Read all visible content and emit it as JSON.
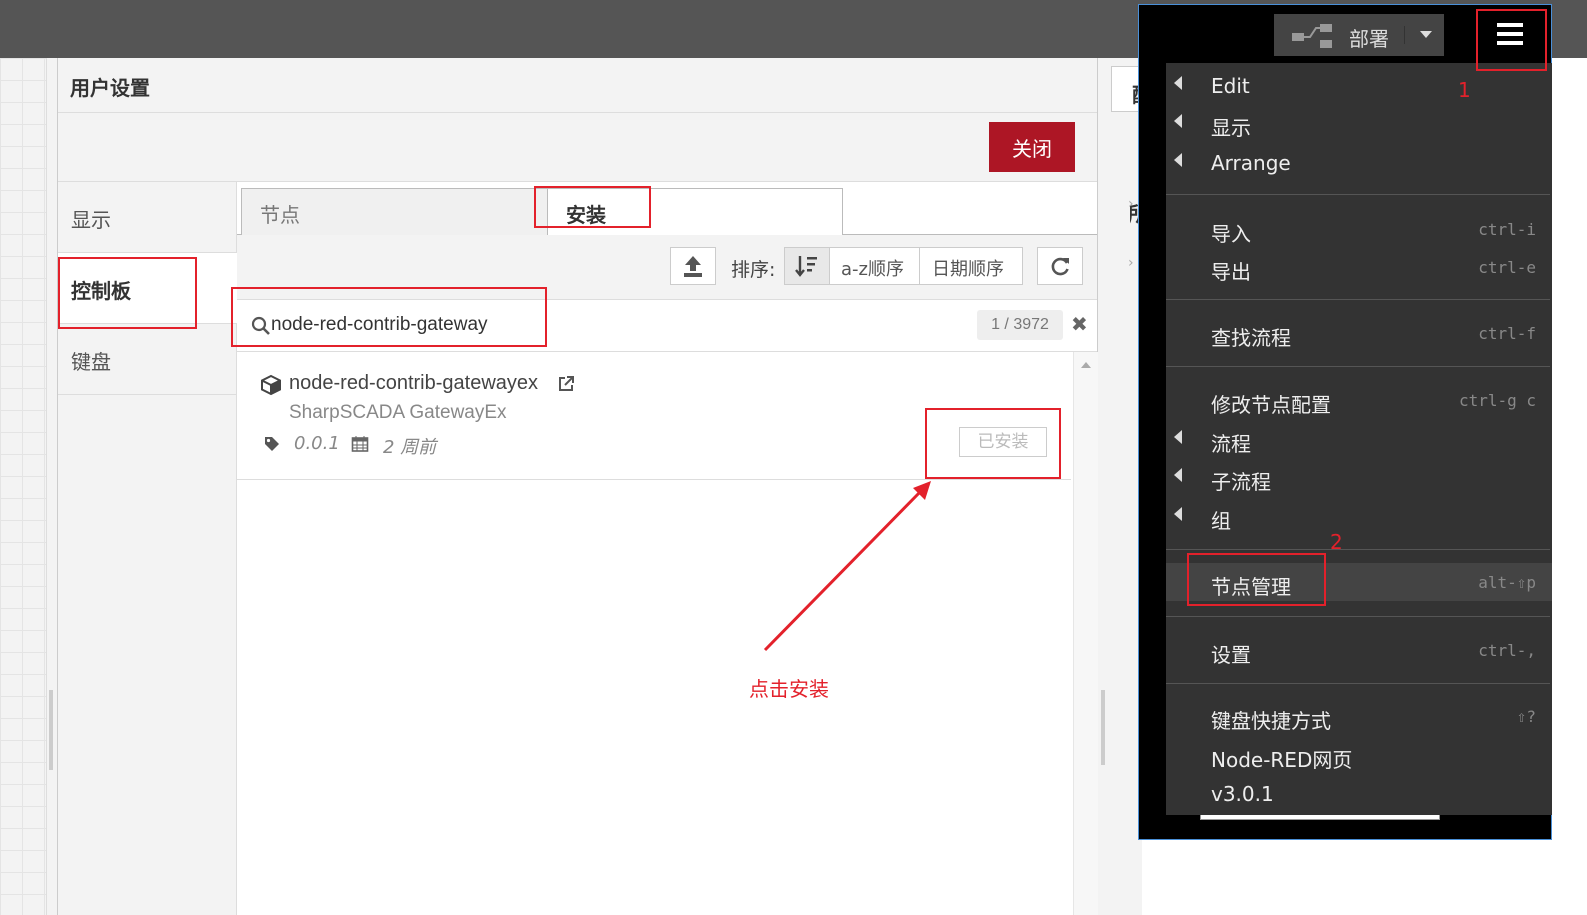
{
  "dialog": {
    "title": "用户设置",
    "close_label": "关闭",
    "sidebar": [
      {
        "label": "显示"
      },
      {
        "label": "控制板"
      },
      {
        "label": "键盘"
      }
    ],
    "tabs": [
      {
        "label": "节点"
      },
      {
        "label": "安装"
      }
    ],
    "sort_label": "排序:",
    "sort_options": [
      "a-z顺序",
      "日期顺序"
    ],
    "search_value": "node-red-contrib-gateway",
    "result_count": "1 / 3972",
    "result": {
      "name": "node-red-contrib-gatewayex",
      "description": "SharpSCADA GatewayEx",
      "version": "0.0.1",
      "updated": "2 周前",
      "status_button": "已安装"
    }
  },
  "background": {
    "right_tab_text": "配置",
    "right_section_text": "所有"
  },
  "header": {
    "deploy_label": "部署"
  },
  "menu": {
    "items": [
      {
        "label": "Edit",
        "submenu": true
      },
      {
        "label": "显示",
        "submenu": true
      },
      {
        "label": "Arrange",
        "submenu": true
      },
      {
        "label": "导入",
        "shortcut": "ctrl-i"
      },
      {
        "label": "导出",
        "shortcut": "ctrl-e"
      },
      {
        "label": "查找流程",
        "shortcut": "ctrl-f"
      },
      {
        "label": "修改节点配置",
        "shortcut": "ctrl-g c"
      },
      {
        "label": "流程",
        "submenu": true
      },
      {
        "label": "子流程",
        "submenu": true
      },
      {
        "label": "组",
        "submenu": true
      },
      {
        "label": "节点管理",
        "shortcut": "alt-⇧p"
      },
      {
        "label": "设置",
        "shortcut": "ctrl-,"
      },
      {
        "label": "键盘快捷方式",
        "shortcut": "⇧?"
      },
      {
        "label": "Node-RED网页"
      },
      {
        "label": "v3.0.1"
      }
    ]
  },
  "annotations": {
    "step1": "1",
    "step2": "2",
    "hint": "点击安装"
  },
  "colors": {
    "accent_red": "#ad1625",
    "annotation_red": "#e3212b",
    "menu_bg": "#333333"
  }
}
